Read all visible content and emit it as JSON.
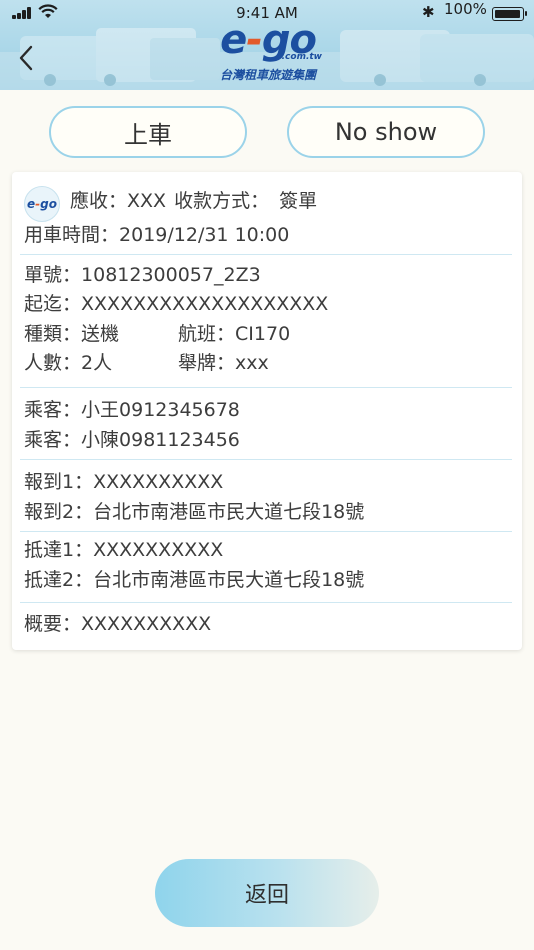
{
  "status_bar": {
    "time": "9:41 AM",
    "battery": "100%",
    "battery_level": 1.0
  },
  "header": {
    "logo_text_e": "e",
    "logo_text_dash": "-",
    "logo_text_go": "go",
    "logo_domain": ".com.tw",
    "logo_subtitle": "台灣租車旅遊集團",
    "back_icon": "chevron-left-icon"
  },
  "actions": {
    "board_label": "上車",
    "noshow_label": "No show"
  },
  "order": {
    "card_logo_e": "e",
    "card_logo_dash": "-",
    "card_logo_go": "go",
    "receivable_label": "應收：",
    "receivable_value": "XXX",
    "payment_label": "收款方式：",
    "payment_value": "簽單",
    "time_label": "用車時間：",
    "time_value": "2019/12/31 10:00",
    "order_no_label": "單號：",
    "order_no_value": "10812300057_2Z3",
    "route_label": "起迄：",
    "route_value": "XXXXXXXXXXXXXXXXXXX",
    "type_label": "種類：",
    "type_value": "送機",
    "flight_label": "航班：",
    "flight_value": "CI170",
    "people_label": "人數：",
    "people_value": "2人",
    "sign_label": "舉牌：",
    "sign_value": "xxx",
    "passengers": [
      {
        "label": "乘客：",
        "value": "小王0912345678"
      },
      {
        "label": "乘客：",
        "value": "小陳0981123456"
      }
    ],
    "checkins": [
      {
        "label": "報到1：",
        "value": "XXXXXXXXXX"
      },
      {
        "label": "報到2：",
        "value": "台北市南港區市民大道七段18號"
      }
    ],
    "arrivals": [
      {
        "label": "抵達1：",
        "value": "XXXXXXXXXX"
      },
      {
        "label": "抵達2：",
        "value": "台北市南港區市民大道七段18號"
      }
    ],
    "summary_label": "概要：",
    "summary_value": "XXXXXXXXXX"
  },
  "footer": {
    "return_label": "返回"
  },
  "colors": {
    "accent": "#9bd3e9",
    "brand_blue": "#1c4fa0",
    "brand_orange": "#e35a2b",
    "background": "#fbfaf4"
  }
}
